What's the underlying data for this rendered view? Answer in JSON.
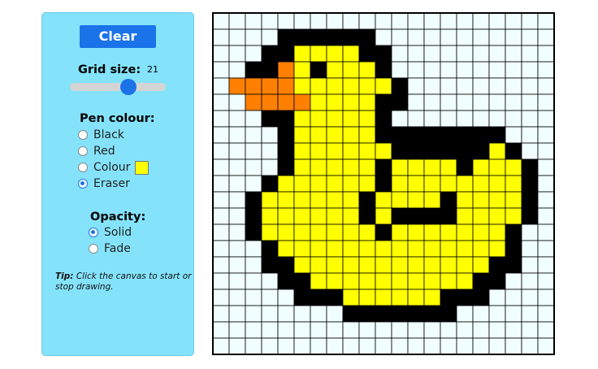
{
  "controls": {
    "clear_label": "Clear",
    "grid_size_label": "Grid size:",
    "grid_size_value": "21",
    "pen_colour_label": "Pen colour:",
    "pen_options": [
      "Black",
      "Red",
      "Colour",
      "Eraser"
    ],
    "pen_selected": "Eraser",
    "custom_colour": "#ffff00",
    "opacity_label": "Opacity:",
    "opacity_options": [
      "Solid",
      "Fade"
    ],
    "opacity_selected": "Solid",
    "tip_label": "Tip:",
    "tip_text": "Click the canvas to start or stop drawing."
  },
  "canvas": {
    "grid_size": 21,
    "palette": {
      "W": "#f1feff",
      "K": "#000000",
      "Y": "#ffff00",
      "O": "#ff8000"
    },
    "rows": [
      "WWWWWWWWWWWWWWWWWWWWW",
      "WWWWKKKKKKWWWWWWWWWWW",
      "WWWKKYYYYKKWWWWWWWWWW",
      "WWKKOYKYYYKWWWWWWWWWW",
      "WOOOOYYYYYYKWWWWWWWWW",
      "WWOOOOYYYYKKWWWWWWWWW",
      "WWWKKYYYYYKWWWWWWWWWW",
      "WWWWKYYYYYKKKKKKKKWWW",
      "WWWWKYYYYYYKKKKKKYKWW",
      "WWWWKYYYYYKYYYYKYYYKW",
      "WWWKYYYYYYKYYYYYYYYKW",
      "WWKYYYYYYKYYYYKYYYYKW",
      "WWKYYYYYYKYKKKKYYYYKW",
      "WWKYYYYYYYKYYYYYYYKWW",
      "WWWKYYYYYYYYYYYYYYKWW",
      "WWWKKYYYYYYYYYYYYKKWW",
      "WWWWKKYYYYYYYYYYKKWWW",
      "WWWWWKKKYYYYYYKKKWWWW",
      "WWWWWWWWKKKKKKKWWWWWW",
      "WWWWWWWWWWWWWWWWWWWWW",
      "WWWWWWWWWWWWWWWWWWWWW"
    ]
  }
}
